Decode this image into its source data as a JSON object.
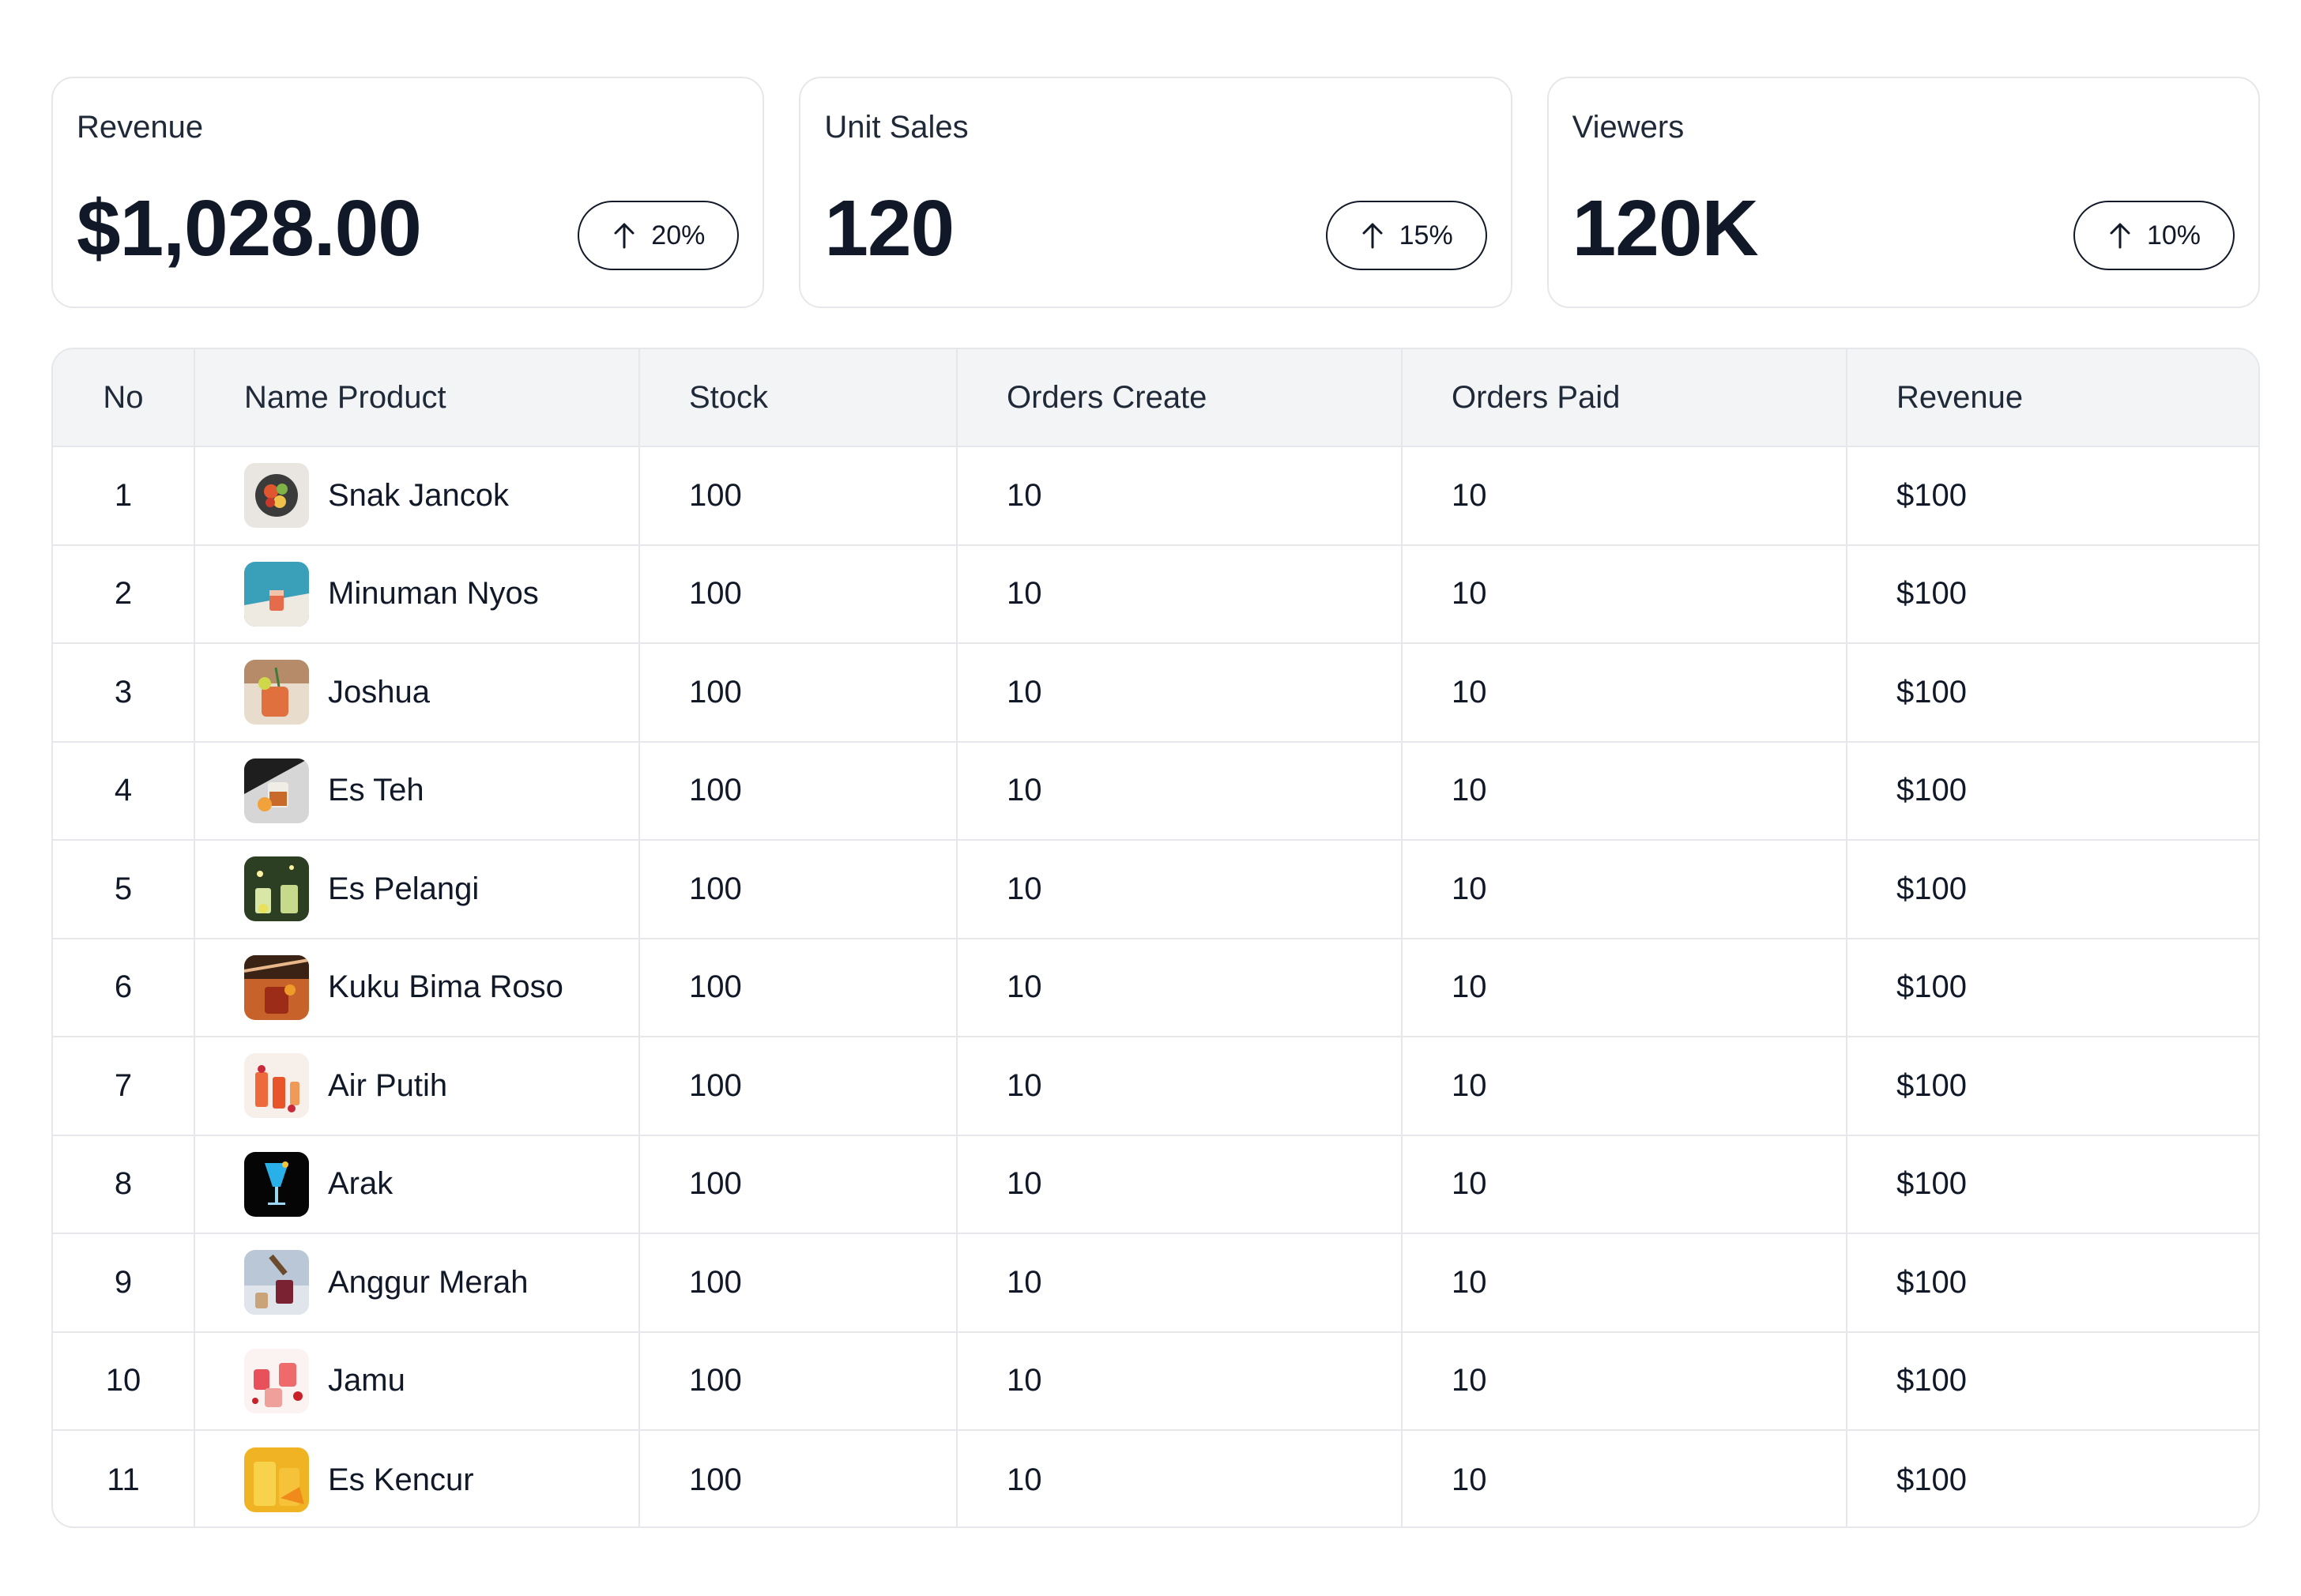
{
  "stats": [
    {
      "label": "Revenue",
      "value": "$1,028.00",
      "change": "20%"
    },
    {
      "label": "Unit Sales",
      "value": "120",
      "change": "15%"
    },
    {
      "label": "Viewers",
      "value": "120K",
      "change": "10%"
    }
  ],
  "table": {
    "headers": {
      "no": "No",
      "name": "Name Product",
      "stock": "Stock",
      "orders_create": "Orders Create",
      "orders_paid": "Orders Paid",
      "revenue": "Revenue"
    },
    "rows": [
      {
        "no": "1",
        "name": "Snak Jancok",
        "stock": "100",
        "orders_create": "10",
        "orders_paid": "10",
        "revenue": "$100"
      },
      {
        "no": "2",
        "name": "Minuman Nyos",
        "stock": "100",
        "orders_create": "10",
        "orders_paid": "10",
        "revenue": "$100"
      },
      {
        "no": "3",
        "name": "Joshua",
        "stock": "100",
        "orders_create": "10",
        "orders_paid": "10",
        "revenue": "$100"
      },
      {
        "no": "4",
        "name": "Es Teh",
        "stock": "100",
        "orders_create": "10",
        "orders_paid": "10",
        "revenue": "$100"
      },
      {
        "no": "5",
        "name": "Es Pelangi",
        "stock": "100",
        "orders_create": "10",
        "orders_paid": "10",
        "revenue": "$100"
      },
      {
        "no": "6",
        "name": "Kuku Bima Roso",
        "stock": "100",
        "orders_create": "10",
        "orders_paid": "10",
        "revenue": "$100"
      },
      {
        "no": "7",
        "name": "Air Putih",
        "stock": "100",
        "orders_create": "10",
        "orders_paid": "10",
        "revenue": "$100"
      },
      {
        "no": "8",
        "name": "Arak",
        "stock": "100",
        "orders_create": "10",
        "orders_paid": "10",
        "revenue": "$100"
      },
      {
        "no": "9",
        "name": "Anggur Merah",
        "stock": "100",
        "orders_create": "10",
        "orders_paid": "10",
        "revenue": "$100"
      },
      {
        "no": "10",
        "name": "Jamu",
        "stock": "100",
        "orders_create": "10",
        "orders_paid": "10",
        "revenue": "$100"
      },
      {
        "no": "11",
        "name": "Es Kencur",
        "stock": "100",
        "orders_create": "10",
        "orders_paid": "10",
        "revenue": "$100"
      }
    ]
  },
  "icons": {
    "trend": "arrow-up-icon",
    "product": "product-thumbnail"
  },
  "colors": {
    "text": "#111827",
    "border": "#e5e7eb",
    "header_bg": "#f3f4f6"
  }
}
